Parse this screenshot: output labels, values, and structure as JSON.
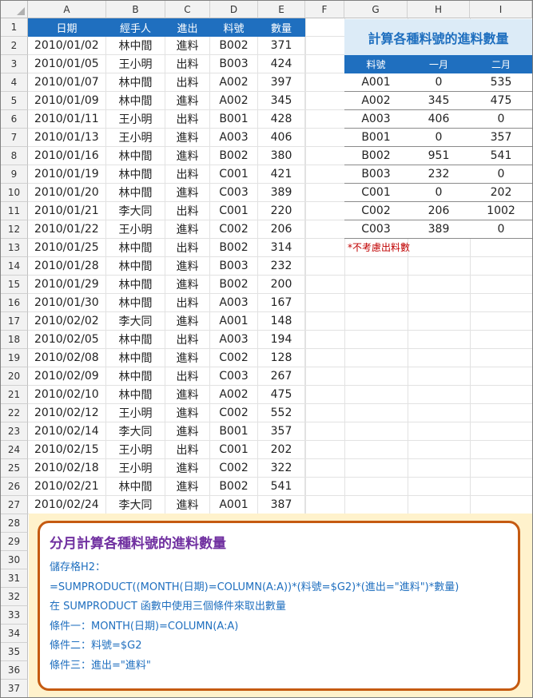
{
  "columns": [
    "A",
    "B",
    "C",
    "D",
    "E",
    "F",
    "G",
    "H",
    "I"
  ],
  "rows": [
    "1",
    "2",
    "3",
    "4",
    "5",
    "6",
    "7",
    "8",
    "9",
    "10",
    "11",
    "12",
    "13",
    "14",
    "15",
    "16",
    "17",
    "18",
    "19",
    "20",
    "21",
    "22",
    "23",
    "24",
    "25",
    "26",
    "27",
    "28",
    "29",
    "30",
    "31",
    "32",
    "33",
    "34",
    "35",
    "36",
    "37"
  ],
  "data_table": {
    "headers": [
      "日期",
      "經手人",
      "進出",
      "料號",
      "數量"
    ],
    "rows": [
      [
        "2010/01/02",
        "林中間",
        "進料",
        "B002",
        "371"
      ],
      [
        "2010/01/05",
        "王小明",
        "出料",
        "B003",
        "424"
      ],
      [
        "2010/01/07",
        "林中間",
        "出料",
        "A002",
        "397"
      ],
      [
        "2010/01/09",
        "林中間",
        "進料",
        "A002",
        "345"
      ],
      [
        "2010/01/11",
        "王小明",
        "出料",
        "B001",
        "428"
      ],
      [
        "2010/01/13",
        "王小明",
        "進料",
        "A003",
        "406"
      ],
      [
        "2010/01/16",
        "林中間",
        "進料",
        "B002",
        "380"
      ],
      [
        "2010/01/19",
        "林中間",
        "出料",
        "C001",
        "421"
      ],
      [
        "2010/01/20",
        "林中間",
        "進料",
        "C003",
        "389"
      ],
      [
        "2010/01/21",
        "李大同",
        "出料",
        "C001",
        "220"
      ],
      [
        "2010/01/22",
        "王小明",
        "進料",
        "C002",
        "206"
      ],
      [
        "2010/01/25",
        "林中間",
        "出料",
        "B002",
        "314"
      ],
      [
        "2010/01/28",
        "林中間",
        "進料",
        "B003",
        "232"
      ],
      [
        "2010/01/29",
        "林中間",
        "進料",
        "B002",
        "200"
      ],
      [
        "2010/01/30",
        "林中間",
        "出料",
        "A003",
        "167"
      ],
      [
        "2010/02/02",
        "李大同",
        "進料",
        "A001",
        "148"
      ],
      [
        "2010/02/05",
        "林中間",
        "出料",
        "A003",
        "194"
      ],
      [
        "2010/02/08",
        "林中間",
        "進料",
        "C002",
        "128"
      ],
      [
        "2010/02/09",
        "林中間",
        "出料",
        "C003",
        "267"
      ],
      [
        "2010/02/10",
        "林中間",
        "進料",
        "A002",
        "475"
      ],
      [
        "2010/02/12",
        "王小明",
        "進料",
        "C002",
        "552"
      ],
      [
        "2010/02/14",
        "李大同",
        "進料",
        "B001",
        "357"
      ],
      [
        "2010/02/15",
        "王小明",
        "出料",
        "C001",
        "202"
      ],
      [
        "2010/02/18",
        "王小明",
        "進料",
        "C002",
        "322"
      ],
      [
        "2010/02/21",
        "林中間",
        "進料",
        "B002",
        "541"
      ],
      [
        "2010/02/24",
        "李大同",
        "進料",
        "A001",
        "387"
      ]
    ]
  },
  "summary": {
    "title": "計算各種料號的進料數量",
    "headers": [
      "料號",
      "一月",
      "二月"
    ],
    "rows": [
      [
        "A001",
        "0",
        "535"
      ],
      [
        "A002",
        "345",
        "475"
      ],
      [
        "A003",
        "406",
        "0"
      ],
      [
        "B001",
        "0",
        "357"
      ],
      [
        "B002",
        "951",
        "541"
      ],
      [
        "B003",
        "232",
        "0"
      ],
      [
        "C001",
        "0",
        "202"
      ],
      [
        "C002",
        "206",
        "1002"
      ],
      [
        "C003",
        "389",
        "0"
      ]
    ],
    "note": "*不考慮出料數"
  },
  "info": {
    "title": "分月計算各種料號的進料數量",
    "lines": [
      "儲存格H2：",
      "=SUMPRODUCT((MONTH(日期)=COLUMN(A:A))*(料號=$G2)*(進出=\"進料\")*數量)",
      "在 SUMPRODUCT 函數中使用三個條件來取出數量",
      "條件一：MONTH(日期)=COLUMN(A:A)",
      "條件二：料號=$G2",
      "條件三：進出=\"進料\""
    ]
  }
}
